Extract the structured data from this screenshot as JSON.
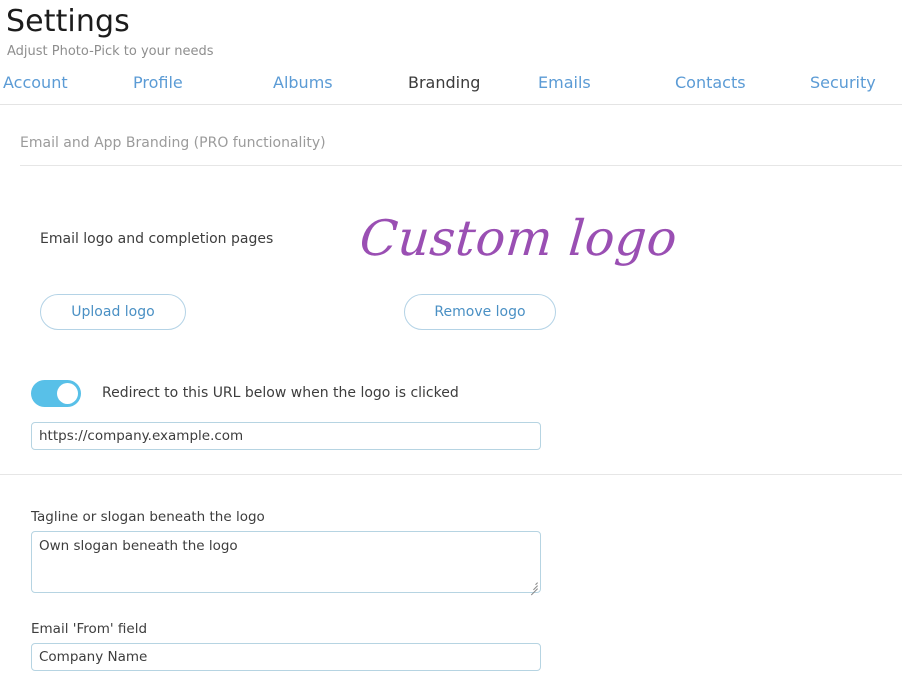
{
  "header": {
    "title": "Settings",
    "subtitle": "Adjust Photo-Pick to your needs"
  },
  "tabs": [
    {
      "label": "Account",
      "active": false
    },
    {
      "label": "Profile",
      "active": false
    },
    {
      "label": "Albums",
      "active": false
    },
    {
      "label": "Branding",
      "active": true
    },
    {
      "label": "Emails",
      "active": false
    },
    {
      "label": "Contacts",
      "active": false
    },
    {
      "label": "Security",
      "active": false
    }
  ],
  "section": {
    "heading": "Email and App Branding (PRO functionality)"
  },
  "logo": {
    "caption": "Email logo and completion pages",
    "artwork_text": "Custom logo",
    "artwork_color": "#9a4fb3",
    "upload_button": "Upload logo",
    "remove_button": "Remove logo"
  },
  "redirect": {
    "toggle_state": "on",
    "toggle_color": "#58c0e8",
    "label": "Redirect to this URL below when the logo is clicked",
    "url_value": "https://company.example.com",
    "url_placeholder": "https://company.example.com"
  },
  "tagline": {
    "label": "Tagline or slogan beneath the logo",
    "value": "Own slogan beneath the logo",
    "placeholder": "Own slogan beneath the logo"
  },
  "email_from": {
    "label": "Email 'From' field",
    "value": "Company Name",
    "placeholder": "Company Name"
  },
  "theme": {
    "link_color": "#5b9bd5",
    "active_tab_color": "#3b3b3b",
    "muted_color": "#9b9b9b",
    "border_color": "#b6d4e2",
    "divider_color": "#e6e6e6"
  }
}
